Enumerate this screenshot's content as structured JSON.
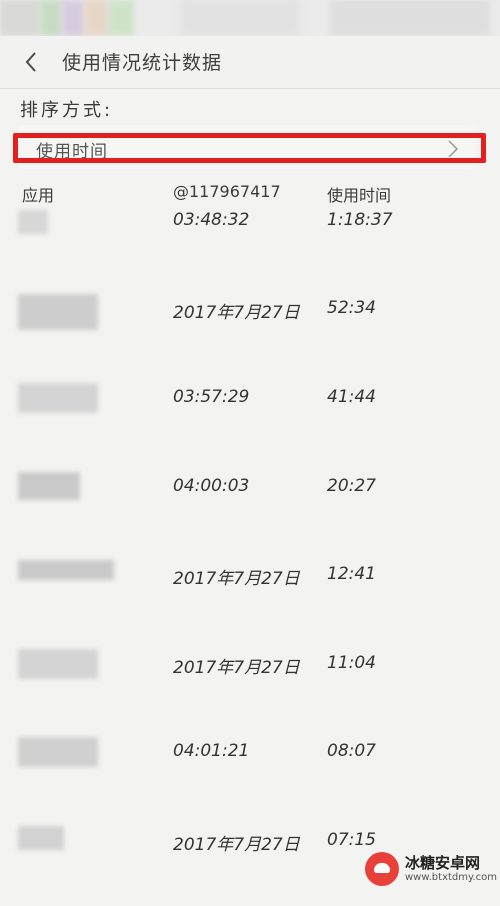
{
  "header": {
    "title": "使用情况统计数据"
  },
  "sort": {
    "label": "排序方式:",
    "value": "使用时间"
  },
  "columns": {
    "app": "应用",
    "date": "@117967417",
    "duration": "使用时间"
  },
  "rows": [
    {
      "date": "03:48:32",
      "duration": "1:18:37"
    },
    {
      "date": "2017年7月27日",
      "duration": "52:34"
    },
    {
      "date": "03:57:29",
      "duration": "41:44"
    },
    {
      "date": "04:00:03",
      "duration": "20:27"
    },
    {
      "date": "2017年7月27日",
      "duration": "12:41"
    },
    {
      "date": "2017年7月27日",
      "duration": "11:04"
    },
    {
      "date": "04:01:21",
      "duration": "08:07"
    },
    {
      "date": "2017年7月27日",
      "duration": "07:15"
    }
  ],
  "watermark": {
    "name": "冰糖安卓网",
    "url": "www.btxtdmy.com"
  },
  "colors": {
    "highlight": "#e41f1f",
    "background": "#f3f3f1"
  },
  "icons": {
    "back": "chevron-left-icon",
    "forward": "chevron-right-icon"
  }
}
